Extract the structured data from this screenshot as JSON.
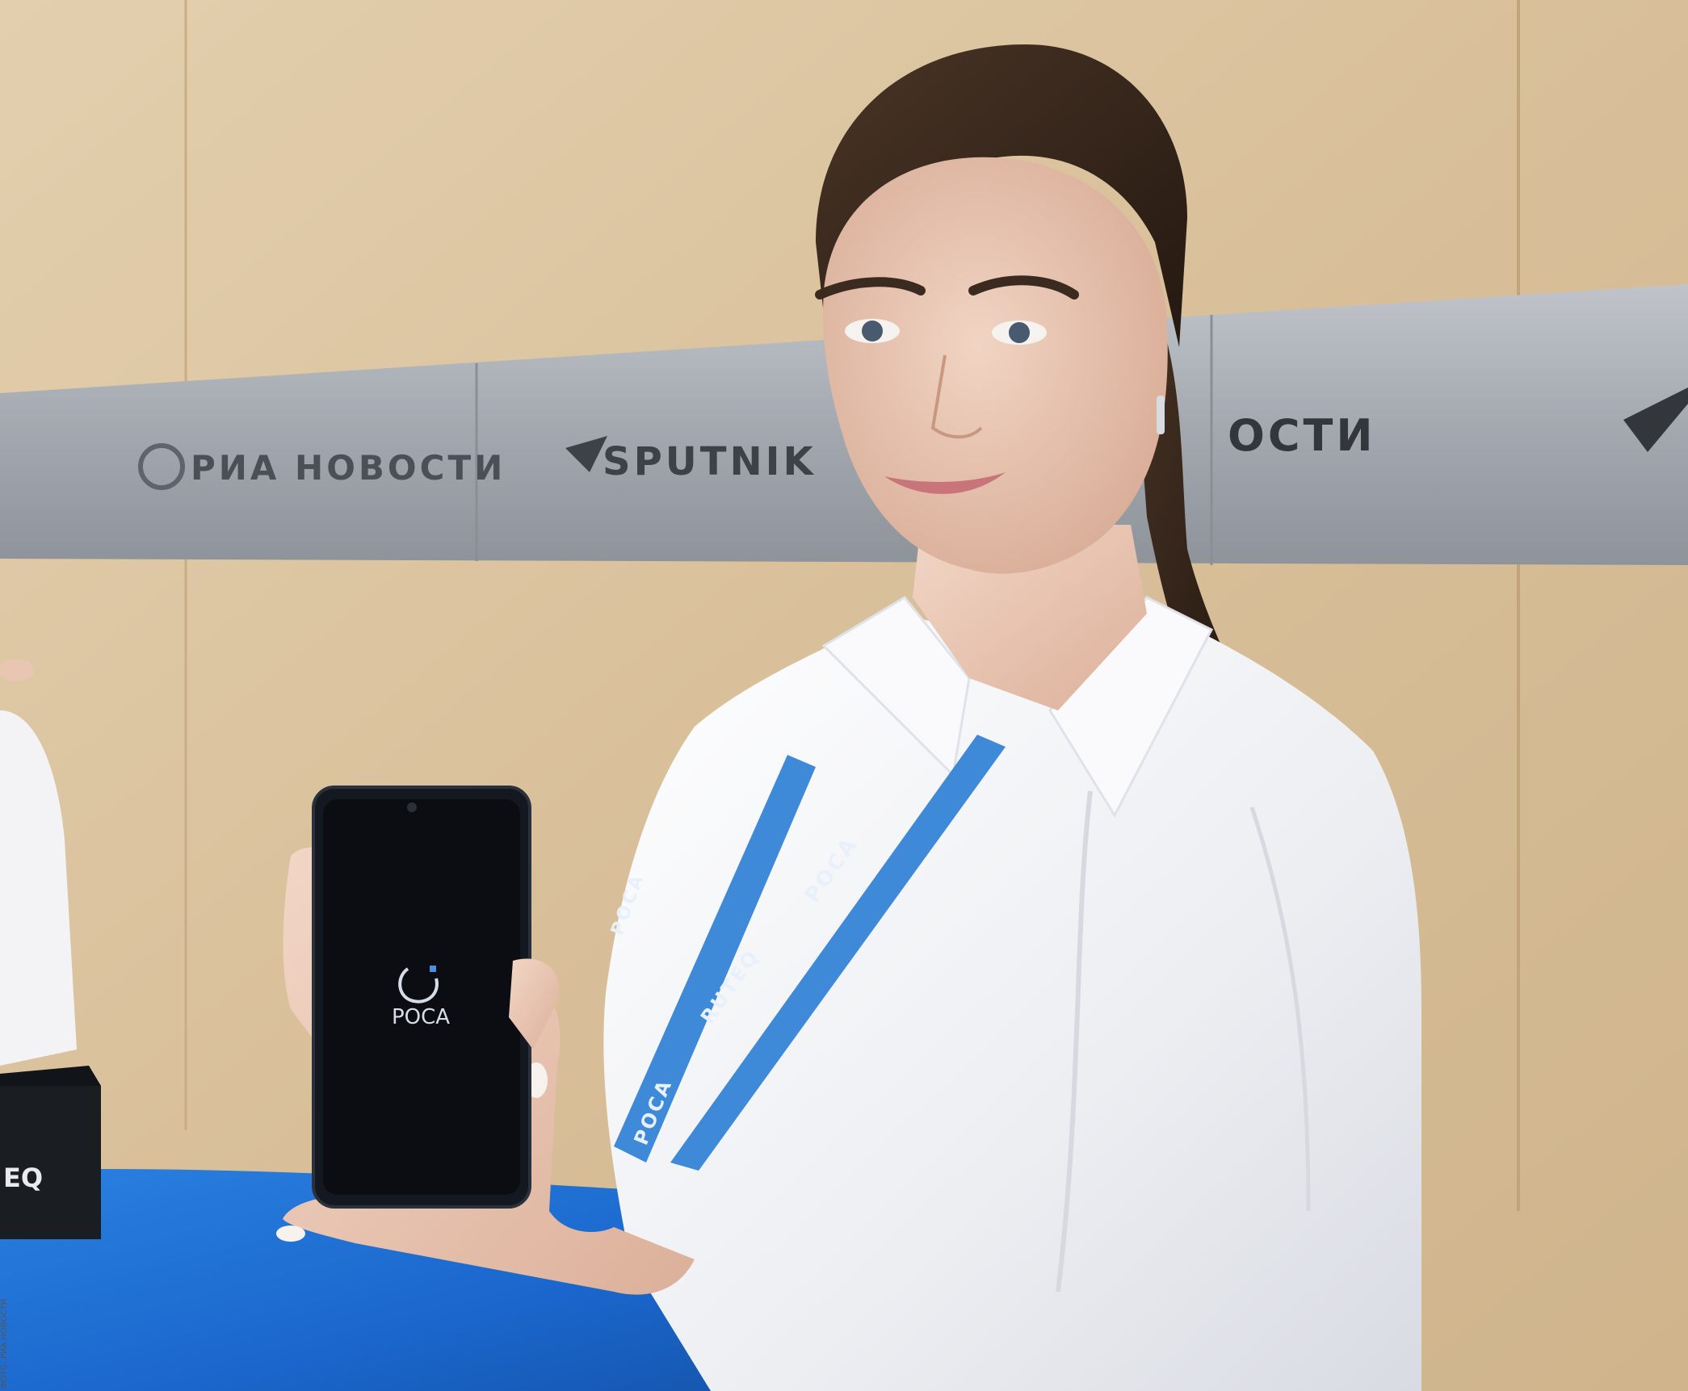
{
  "photo": {
    "wall_sign": {
      "logo_1": "РИА НОВОСТИ",
      "logo_2": "SPUTNIK",
      "logo_3": "ОСТИ"
    },
    "phone_screen": {
      "brand": "РОСА"
    },
    "lanyard": {
      "brand_1": "РОСА",
      "brand_2": "RUTEQ",
      "brand_3": "РОСА",
      "brand_4": "РОСА"
    },
    "box_label": "EQ",
    "photo_credit": "ФОТО: РИА НОВОСТИ"
  },
  "colors": {
    "wall": "#d9c19c",
    "sign_strip": "#a9adb3",
    "counter": "#1d6fd6",
    "shirt": "#f4f4f6",
    "lanyard": "#3f8ad8",
    "phone": "#141820"
  }
}
